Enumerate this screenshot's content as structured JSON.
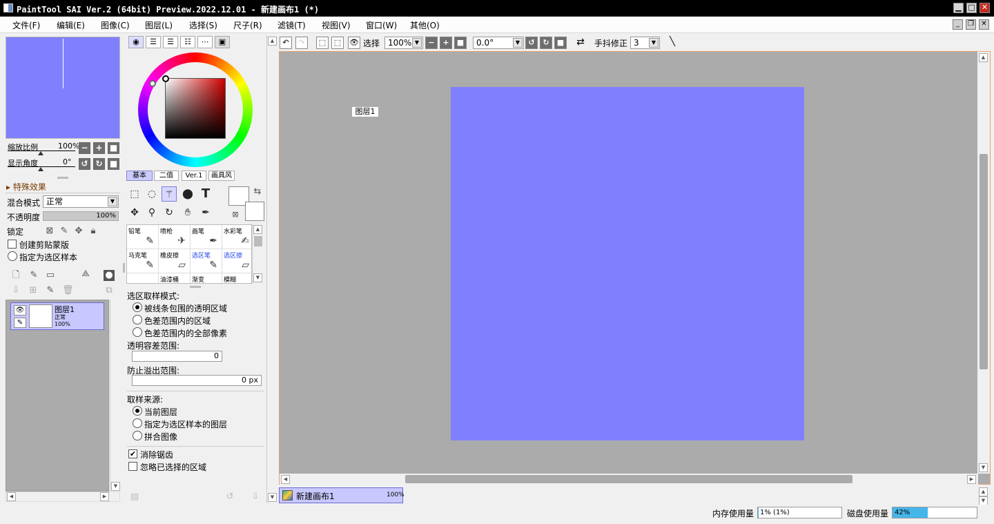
{
  "window": {
    "title": "PaintTool SAI Ver.2 (64bit) Preview.2022.12.01 - 新建画布1 (*)",
    "min": "▁",
    "max": "□",
    "close": "✕"
  },
  "menu": [
    "文件(F)",
    "编辑(E)",
    "图像(C)",
    "图层(L)",
    "选择(S)",
    "尺子(R)",
    "滤镜(T)",
    "视图(V)",
    "窗口(W)",
    "其他(O)"
  ],
  "navigator": {
    "zoom_label": "缩放比例",
    "zoom_value": "100%",
    "angle_label": "显示角度",
    "angle_value": "0°"
  },
  "layer_panel": {
    "special_effects": "特殊效果",
    "blend_label": "混合模式",
    "blend_value": "正常",
    "opacity_label": "不透明度",
    "opacity_value": "100%",
    "lock_label": "锁定",
    "clip_label": "创建剪贴蒙版",
    "sample_label": "指定为选区样本",
    "layer": {
      "name": "图层1",
      "mode": "正常",
      "opacity": "100%"
    }
  },
  "color_tabs": [
    "基本",
    "二值",
    "Ver.1",
    "画具风"
  ],
  "brushes": [
    {
      "name": "铅笔",
      "icon": "✎",
      "blue": false
    },
    {
      "name": "喷枪",
      "icon": "✈",
      "blue": false
    },
    {
      "name": "画笔",
      "icon": "✒",
      "blue": false
    },
    {
      "name": "水彩笔",
      "icon": "✍",
      "blue": false
    },
    {
      "name": "马克笔",
      "icon": "✎",
      "blue": false
    },
    {
      "name": "橡皮擦",
      "icon": "▱",
      "blue": false
    },
    {
      "name": "选区笔",
      "icon": "✎",
      "blue": true
    },
    {
      "name": "选区擦",
      "icon": "▱",
      "blue": true
    },
    {
      "name": "",
      "icon": "",
      "blue": false
    },
    {
      "name": "油漆桶",
      "icon": "",
      "blue": false
    },
    {
      "name": "渐变",
      "icon": "",
      "blue": false
    },
    {
      "name": "模糊",
      "icon": "",
      "blue": false
    }
  ],
  "tool_options": {
    "mode_title": "选区取样模式:",
    "mode_opts": [
      "被线条包围的透明区域",
      "色差范围内的区域",
      "色差范围内的全部像素"
    ],
    "tol_label": "透明容差范围:",
    "tol_value": "0",
    "overflow_label": "防止溢出范围:",
    "overflow_value": "0 px",
    "source_title": "取样来源:",
    "source_opts": [
      "当前图层",
      "指定为选区样本的图层",
      "拼合图像"
    ],
    "antialias": "消除锯齿",
    "ignore": "忽略已选择的区域"
  },
  "toolbar": {
    "select_label": "选择",
    "zoom_value": "100%",
    "angle_value": "0.0°",
    "stabilizer_label": "手抖修正",
    "stabilizer_value": "3"
  },
  "canvas": {
    "layer_tag": "图层1",
    "paper_color": "#8080ff"
  },
  "doc_tab": {
    "name": "新建画布1",
    "zoom": "100%"
  },
  "status": {
    "mem_label": "内存使用量",
    "mem_value": "1% (1%)",
    "mem_fraction": 0.01,
    "disk_label": "磁盘使用量",
    "disk_value": "42%",
    "disk_fraction": 0.42
  }
}
